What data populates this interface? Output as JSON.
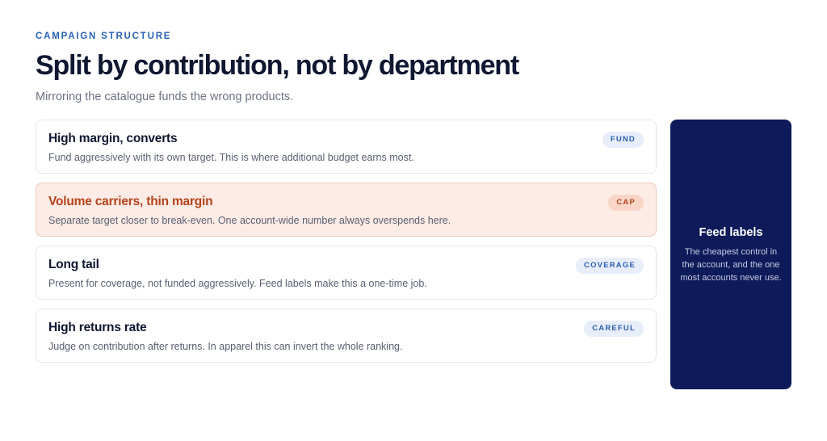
{
  "header": {
    "eyebrow": "CAMPAIGN STRUCTURE",
    "title": "Split by contribution, not by department",
    "subtitle": "Mirroring the catalogue funds the wrong products."
  },
  "cards": [
    {
      "title": "High margin, converts",
      "description": "Fund aggressively with its own target. This is where additional budget earns most.",
      "badge": "FUND",
      "highlighted": false
    },
    {
      "title": "Volume carriers, thin margin",
      "description": "Separate target closer to break-even. One account-wide number always overspends here.",
      "badge": "CAP",
      "highlighted": true
    },
    {
      "title": "Long tail",
      "description": "Present for coverage, not funded aggressively. Feed labels make this a one-time job.",
      "badge": "COVERAGE",
      "highlighted": false
    },
    {
      "title": "High returns rate",
      "description": "Judge on contribution after returns. In apparel this can invert the whole ranking.",
      "badge": "CAREFUL",
      "highlighted": false
    }
  ],
  "side_panel": {
    "title": "Feed labels",
    "text": "The cheapest control in the account, and the one most accounts never use."
  },
  "colors": {
    "accent": "#2962b8",
    "highlight_bg": "#fdebe5",
    "highlight_text": "#b3431b",
    "panel_bg": "#0e1b5a"
  }
}
